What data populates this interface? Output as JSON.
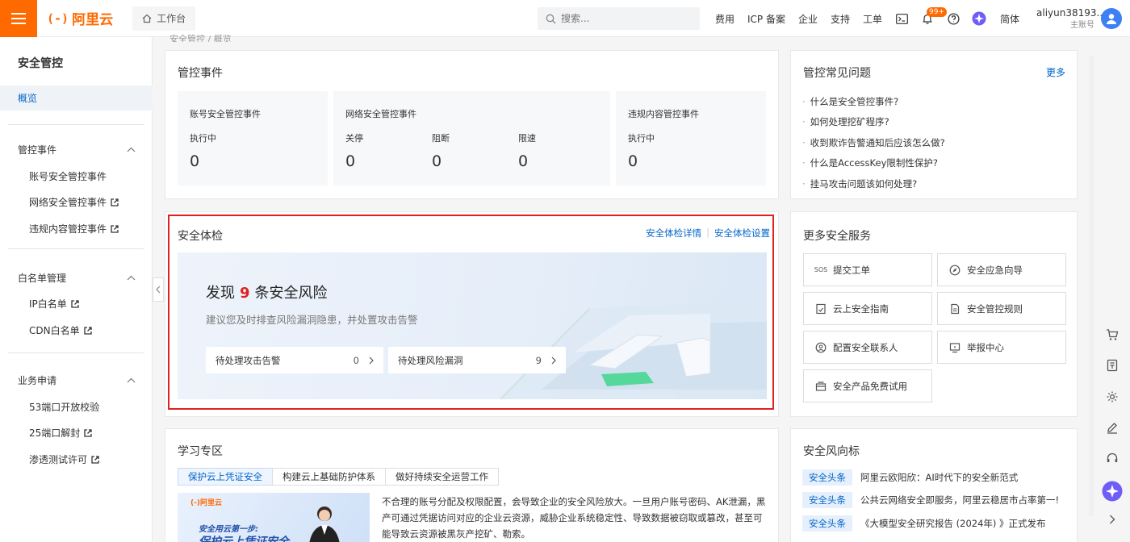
{
  "topbar": {
    "brand": "阿里云",
    "brand_mark": "(-)",
    "workbench": "工作台",
    "search_placeholder": "搜索...",
    "nav": [
      "费用",
      "ICP 备案",
      "企业",
      "支持",
      "工单"
    ],
    "notification_badge": "99+",
    "language": "简体",
    "account_name": "aliyun38193...",
    "account_role": "主账号"
  },
  "sidebar": {
    "title": "安全管控",
    "active_item": "概览",
    "groups": [
      {
        "label": "管控事件",
        "items": [
          "账号安全管控事件",
          "网络安全管控事件",
          "违规内容管控事件"
        ]
      },
      {
        "label": "白名单管理",
        "items": [
          "IP白名单",
          "CDN白名单"
        ]
      },
      {
        "label": "业务申请",
        "items": [
          "53端口开放校验",
          "25端口解封",
          "渗透测试许可"
        ]
      }
    ]
  },
  "breadcrumb": "安全管控 / 概览",
  "events": {
    "title": "管控事件",
    "account": {
      "title": "账号安全管控事件",
      "label": "执行中",
      "value": "0"
    },
    "network": {
      "title": "网络安全管控事件",
      "labels": [
        "关停",
        "阻断",
        "限速"
      ],
      "values": [
        "0",
        "0",
        "0"
      ]
    },
    "content": {
      "title": "违规内容管控事件",
      "label": "执行中",
      "value": "0"
    }
  },
  "checkup": {
    "title": "安全体检",
    "link_detail": "安全体检详情",
    "link_settings": "安全体检设置",
    "headline_prefix": "发现",
    "risk_count": "9",
    "headline_suffix": "条安全风险",
    "subtitle": "建议您及时排查风险漏洞隐患，并处置攻击告警",
    "pending_attacks_label": "待处理攻击告警",
    "pending_attacks_value": "0",
    "pending_vulns_label": "待处理风险漏洞",
    "pending_vulns_value": "9"
  },
  "learning": {
    "title": "学习专区",
    "tabs": [
      "保护云上凭证安全",
      "构建云上基础防护体系",
      "做好持续安全运营工作"
    ],
    "image_logo": "(-)阿里云",
    "image_caption": "安全用云第一步:",
    "image_headline": "保护云上凭证安全",
    "text": "不合理的账号分配及权限配置，会导致企业的安全风险放大。一旦用户账号密码、AK泄漏，黑产可通过凭据访问对应的企业云资源，威胁企业系统稳定性、导致数据被窃取或篡改，甚至可能导致云资源被黑灰产挖矿、勒索。"
  },
  "faq": {
    "title": "管控常见问题",
    "more": "更多",
    "items": [
      "什么是安全管控事件?",
      "如何处理挖矿程序?",
      "收到欺诈告警通知后应该怎么做?",
      "什么是AccessKey限制性保护?",
      "挂马攻击问题该如何处理?"
    ]
  },
  "services": {
    "title": "更多安全服务",
    "items": [
      {
        "label": "提交工单",
        "icon": "sos-icon"
      },
      {
        "label": "安全应急向导",
        "icon": "compass-icon"
      },
      {
        "label": "云上安全指南",
        "icon": "guide-icon"
      },
      {
        "label": "安全管控规则",
        "icon": "document-icon"
      },
      {
        "label": "配置安全联系人",
        "icon": "contact-icon"
      },
      {
        "label": "举报中心",
        "icon": "report-icon"
      },
      {
        "label": "安全产品免费试用",
        "icon": "trial-icon"
      }
    ],
    "sos_text": "SOS"
  },
  "news": {
    "title": "安全风向标",
    "items": [
      {
        "tag": "安全头条",
        "text": "阿里云欧阳欣：AI时代下的安全新范式"
      },
      {
        "tag": "安全头条",
        "text": "公共云网络安全即服务，阿里云稳居市占率第一!"
      },
      {
        "tag": "安全头条",
        "text": "《大模型安全研究报告 (2024年) 》正式发布"
      }
    ]
  },
  "colors": {
    "brand": "#ff6a00",
    "link": "#0064c8",
    "risk": "#e02020"
  }
}
